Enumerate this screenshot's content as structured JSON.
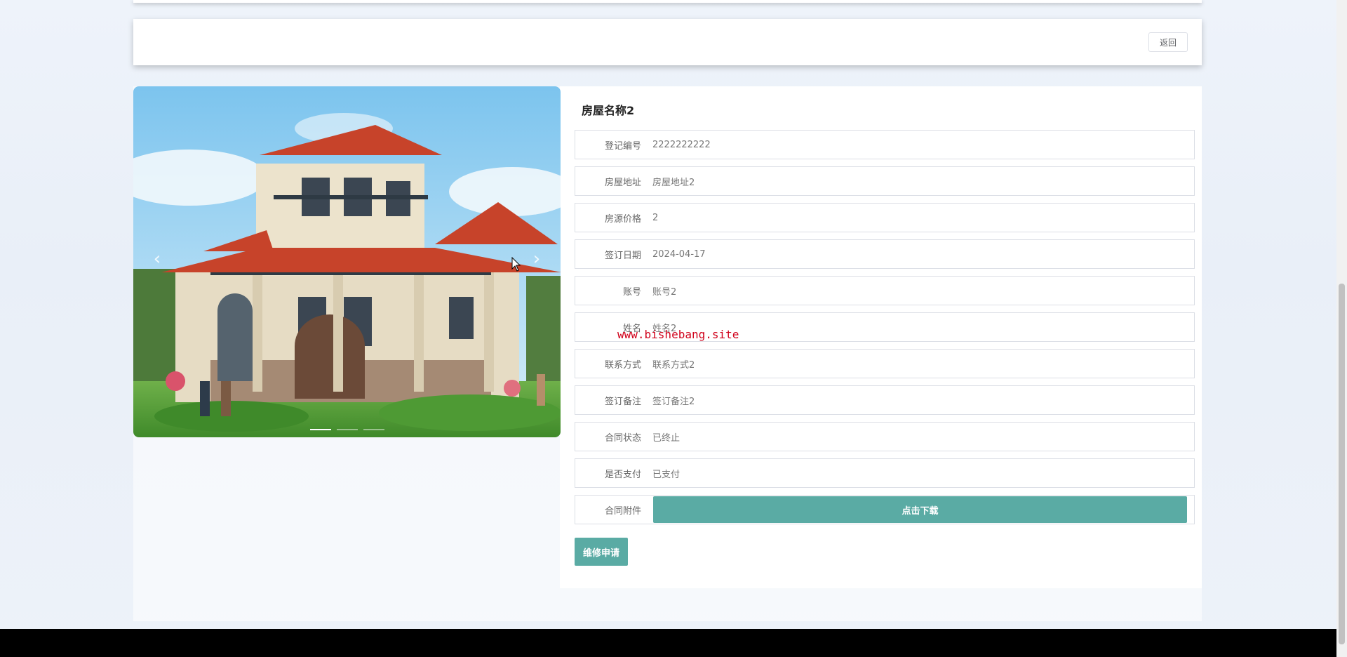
{
  "toolbar": {
    "back_label": "返回"
  },
  "house": {
    "title": "房屋名称2",
    "fields": [
      {
        "label": "登记编号",
        "value": "2222222222"
      },
      {
        "label": "房屋地址",
        "value": "房屋地址2"
      },
      {
        "label": "房源价格",
        "value": "2"
      },
      {
        "label": "签订日期",
        "value": "2024-04-17"
      },
      {
        "label": "账号",
        "value": "账号2"
      },
      {
        "label": "姓名",
        "value": "姓名2"
      },
      {
        "label": "联系方式",
        "value": "联系方式2"
      },
      {
        "label": "签订备注",
        "value": "签订备注2"
      },
      {
        "label": "合同状态",
        "value": "已终止"
      },
      {
        "label": "是否支付",
        "value": "已支付"
      }
    ],
    "attachment": {
      "label": "合同附件",
      "button": "点击下载"
    },
    "repair_button": "维修申请"
  },
  "carousel": {
    "prev_icon": "‹",
    "next_icon": "›",
    "slides_count": 3,
    "active_index": 0
  },
  "watermark": "www.bishebang.site",
  "colors": {
    "accent": "#5aaba4",
    "watermark": "#d0021b"
  }
}
